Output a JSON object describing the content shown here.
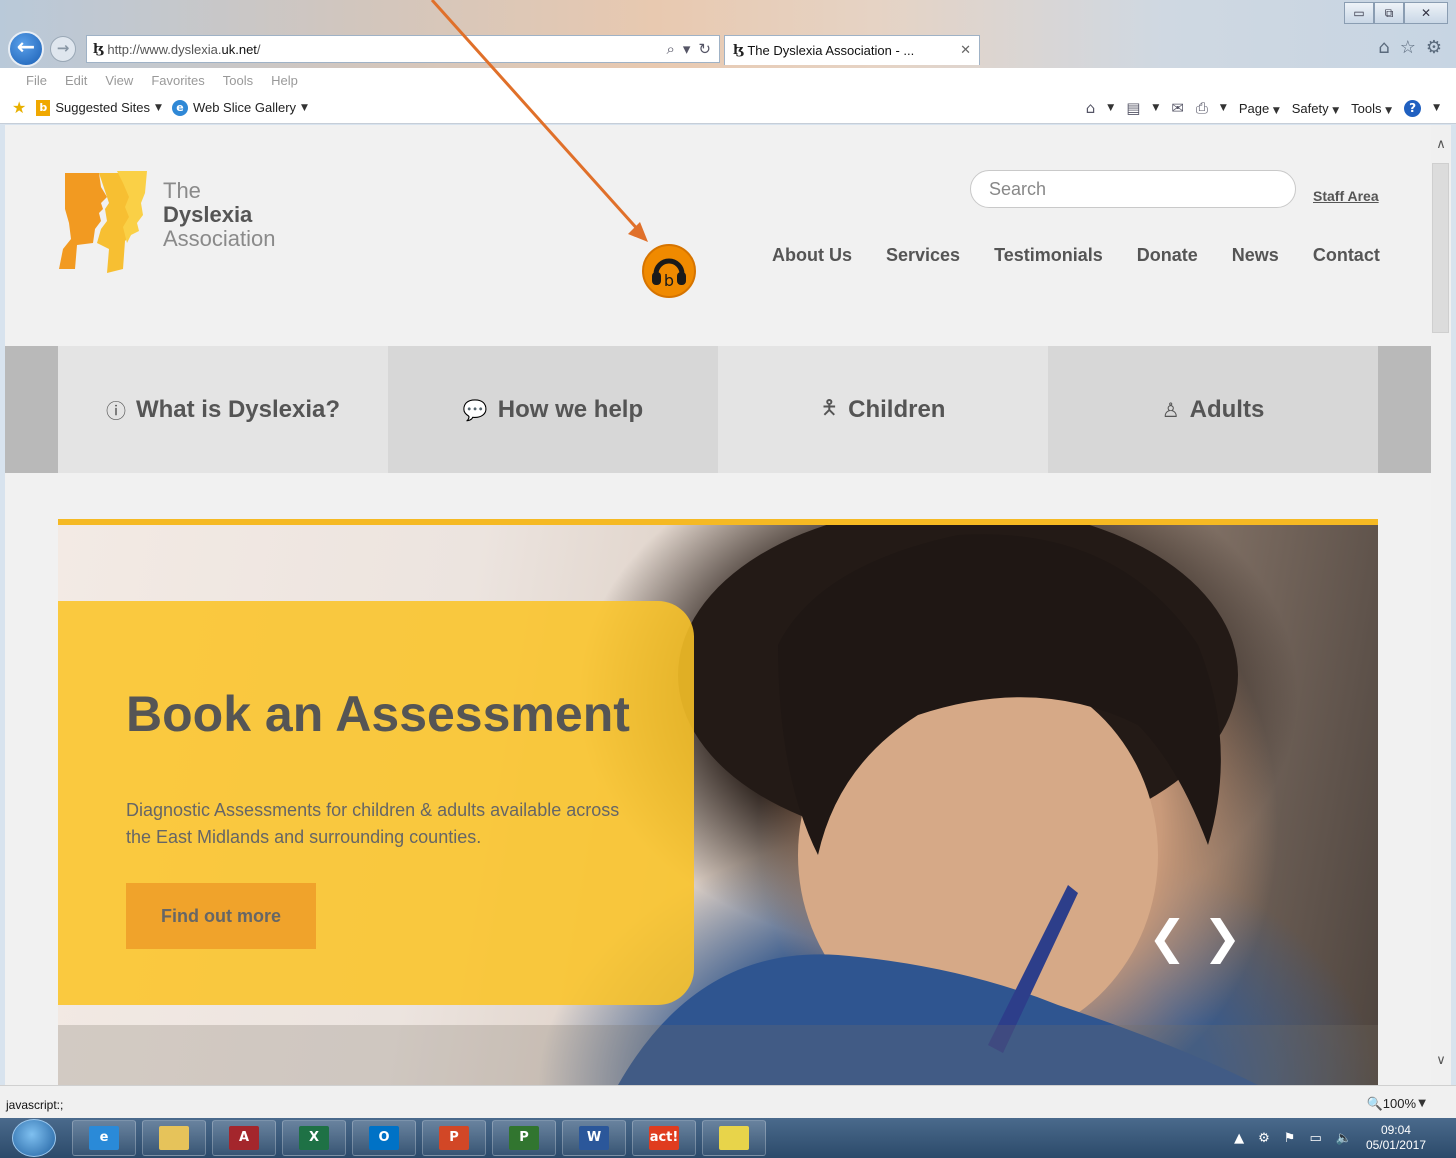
{
  "browser": {
    "url_prefix": "http://www.dyslexia.",
    "url_domain": "uk.net",
    "url_suffix": "/",
    "tab_title": "The Dyslexia Association - ...",
    "tab_close": "✕",
    "window_controls": [
      "▭",
      "⧉",
      "✕"
    ],
    "menu": [
      "File",
      "Edit",
      "View",
      "Favorites",
      "Tools",
      "Help"
    ],
    "favorites": {
      "suggested_sites": "Suggested Sites",
      "web_slice_gallery": "Web Slice Gallery"
    },
    "command_bar": {
      "page": "Page",
      "safety": "Safety",
      "tools": "Tools"
    },
    "status_text": "javascript:;",
    "zoom": "100%"
  },
  "site": {
    "logo": {
      "line1": "The",
      "line2": "Dyslexia",
      "line3": "Association"
    },
    "search_placeholder": "Search",
    "staff_area": "Staff Area",
    "nav": [
      "About Us",
      "Services",
      "Testimonials",
      "Donate",
      "News",
      "Contact"
    ],
    "categories": [
      {
        "label": "What is Dyslexia?",
        "icon": "info-circle-icon"
      },
      {
        "label": "How we help",
        "icon": "comments-icon"
      },
      {
        "label": "Children",
        "icon": "child-icon"
      },
      {
        "label": "Adults",
        "icon": "person-icon"
      }
    ],
    "hero": {
      "title": "Book an Assessment",
      "text": "Diagnostic Assessments for children & adults available across the East Midlands and surrounding counties.",
      "button": "Find out more",
      "prev": "❮",
      "next": "❯"
    }
  },
  "taskbar": {
    "apps": [
      {
        "name": "internet-explorer",
        "label": "e",
        "color": "#2a8ad8"
      },
      {
        "name": "file-explorer",
        "label": "",
        "color": "#e6c35a"
      },
      {
        "name": "access",
        "label": "A",
        "color": "#a4262c"
      },
      {
        "name": "excel",
        "label": "X",
        "color": "#1e7145"
      },
      {
        "name": "outlook",
        "label": "O",
        "color": "#0072c6"
      },
      {
        "name": "powerpoint",
        "label": "P",
        "color": "#d24726"
      },
      {
        "name": "project",
        "label": "P",
        "color": "#31752f"
      },
      {
        "name": "word",
        "label": "W",
        "color": "#2b579a"
      },
      {
        "name": "act",
        "label": "act!",
        "color": "#e03c1f"
      },
      {
        "name": "sticky-notes",
        "label": "",
        "color": "#e8d44a"
      }
    ],
    "clock_time": "09:04",
    "clock_date": "05/01/2017"
  },
  "colors": {
    "accent_orange": "#f08a00",
    "hero_yellow": "#f5b923",
    "nav_text": "#555555",
    "annotation_arrow": "#e0702a"
  }
}
